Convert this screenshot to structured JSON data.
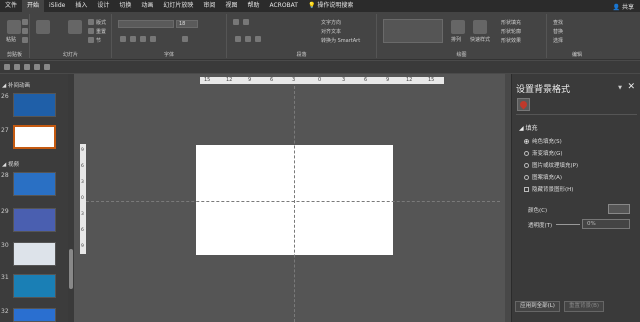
{
  "tabs": [
    "文件",
    "开始",
    "iSlide",
    "插入",
    "设计",
    "切换",
    "动画",
    "幻灯片放映",
    "审阅",
    "视图",
    "帮助",
    "ACROBAT"
  ],
  "active_tab_index": 1,
  "tab_search": "操作说明搜索",
  "share_label": "共享",
  "ribbon": {
    "clipboard": {
      "paste": "粘贴",
      "group": "剪贴板"
    },
    "slides": {
      "new_slide": "新建\n幻灯片",
      "reuse": "重用\n幻灯片",
      "layout": "版式",
      "reset": "重置",
      "section": "节",
      "group": "幻灯片"
    },
    "font": {
      "font_size": "18",
      "group": "字体"
    },
    "paragraph": {
      "group": "段落",
      "text_direction": "文字方向",
      "align_text": "对齐文本",
      "smartart": "转换为 SmartArt"
    },
    "drawing": {
      "arrange": "排列",
      "quick_styles": "快速样式",
      "shape_fill": "形状填充",
      "shape_outline": "形状轮廓",
      "shape_effects": "形状效果",
      "group": "绘图"
    },
    "editing": {
      "find": "查找",
      "replace": "替换",
      "select": "选择",
      "group": "编辑"
    }
  },
  "thumbs": {
    "sections": [
      {
        "label": "◢ 补间动画"
      },
      {
        "label": "◢ 视频"
      }
    ],
    "slides": [
      {
        "num": "26",
        "theme": "blue"
      },
      {
        "num": "27",
        "theme": "blank"
      },
      {
        "num": "28",
        "theme": "blue-calligraphy"
      },
      {
        "num": "29",
        "theme": "blue-purple"
      },
      {
        "num": "30",
        "theme": "white-pattern"
      },
      {
        "num": "31",
        "theme": "teal"
      },
      {
        "num": "32",
        "theme": "blue"
      }
    ]
  },
  "ruler": {
    "h_ticks": [
      "15",
      "12",
      "9",
      "6",
      "3",
      "0",
      "3",
      "6",
      "9",
      "12",
      "15"
    ],
    "v_ticks": [
      "9",
      "6",
      "3",
      "0",
      "3",
      "6",
      "9"
    ]
  },
  "format_pane": {
    "title": "设置背景格式",
    "section": "◢ 填充",
    "options": [
      {
        "label": "纯色填充(S)",
        "selected": true
      },
      {
        "label": "渐变填充(G)",
        "selected": false
      },
      {
        "label": "图片或纹理填充(P)",
        "selected": false
      },
      {
        "label": "图案填充(A)",
        "selected": false
      }
    ],
    "hide_bg": "隐藏背景图形(H)",
    "color_label": "颜色(C)",
    "transparency_label": "透明度(T)",
    "transparency_value": "0%",
    "apply_all": "应用到全部(L)",
    "reset_bg": "重置背景(B)"
  },
  "colors": {
    "accent": "#c55a11"
  }
}
